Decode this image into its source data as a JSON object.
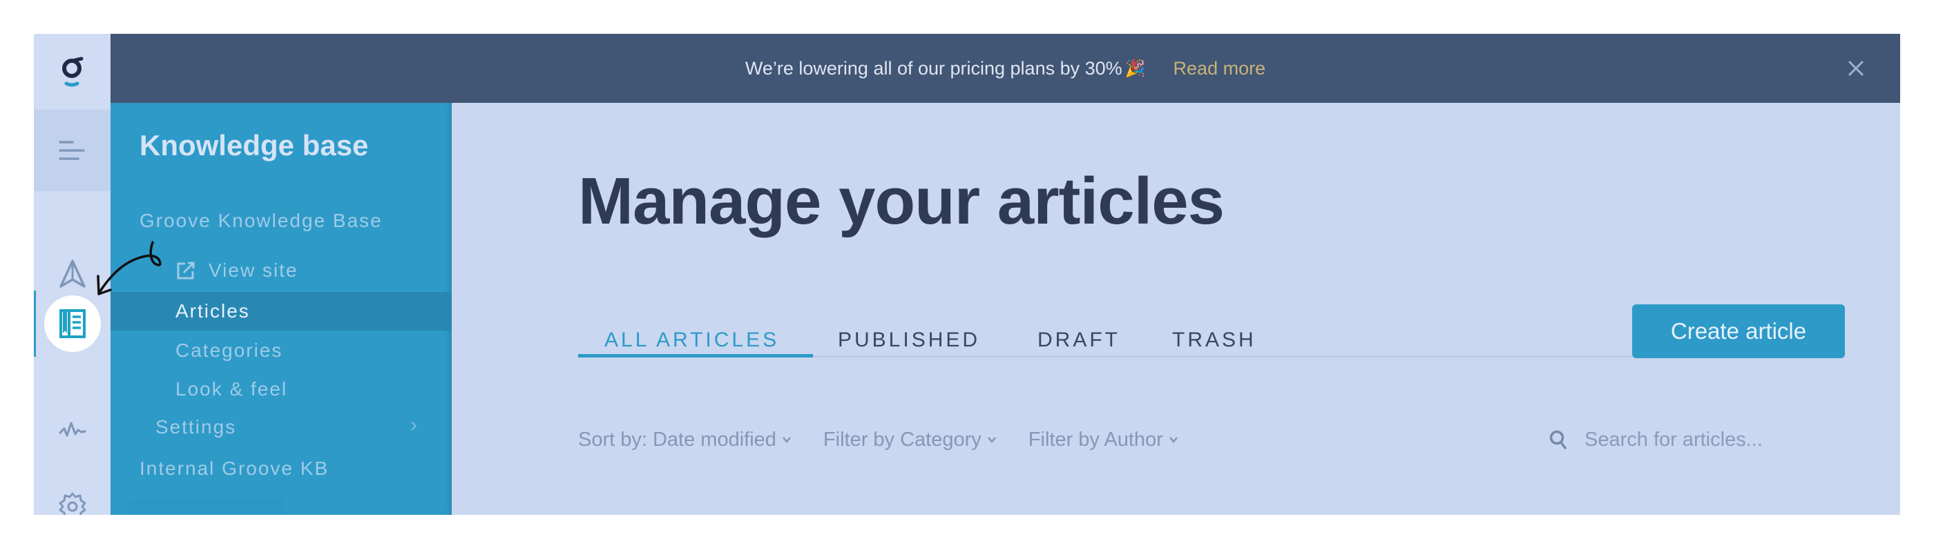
{
  "banner": {
    "message": "We’re lowering all of our pricing plans by 30%",
    "emoji": "🎉",
    "link_label": "Read more",
    "close_icon": "close-icon"
  },
  "rail": {
    "logo_icon": "groove-logo-icon",
    "items": [
      {
        "icon": "menu-lines-icon",
        "active": false
      },
      {
        "icon": "send-arrow-icon",
        "active": false
      },
      {
        "icon": "knowledge-book-icon",
        "active": true
      },
      {
        "icon": "activity-pulse-icon",
        "active": false
      },
      {
        "icon": "gear-icon",
        "active": false
      }
    ]
  },
  "sidebar": {
    "title": "Knowledge base",
    "kb_name": "Groove Knowledge Base",
    "items": [
      {
        "label": "View site",
        "icon": "external-link-icon"
      },
      {
        "label": "Articles",
        "active": true
      },
      {
        "label": "Categories"
      },
      {
        "label": "Look & feel"
      }
    ],
    "settings_label": "Settings",
    "other_kb": "Internal Groove KB"
  },
  "main": {
    "title": "Manage your articles",
    "tabs": [
      {
        "label": "ALL ARTICLES",
        "active": true
      },
      {
        "label": "PUBLISHED",
        "active": false
      },
      {
        "label": "DRAFT",
        "active": false
      },
      {
        "label": "TRASH",
        "active": false
      }
    ],
    "create_button": "Create article",
    "filters": {
      "sort": "Sort by: Date modified",
      "category": "Filter by Category",
      "author": "Filter by Author"
    },
    "search": {
      "placeholder": "Search for articles...",
      "value": ""
    }
  },
  "colors": {
    "accent": "#2d9ac9",
    "banner_bg": "#415574",
    "content_bg": "#c9d7f0",
    "title_text": "#2f3b52",
    "link_gold": "#c8b27a"
  }
}
